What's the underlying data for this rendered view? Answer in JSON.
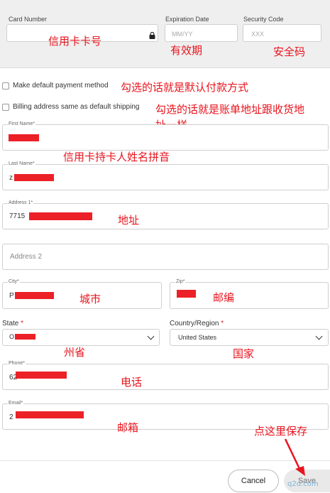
{
  "card": {
    "number_label": "Card Number",
    "expiration_label": "Expiration Date",
    "expiration_placeholder": "MM/YY",
    "security_label": "Security Code",
    "security_placeholder": "XXX",
    "lock_icon": "lock-icon"
  },
  "options": {
    "default_payment_label": "Make default payment method",
    "billing_same_label": "Billing address same as default shipping"
  },
  "fields": {
    "first_name_label": "First Name*",
    "last_name_label": "Last Name*",
    "last_name_value_visible": "z",
    "address1_label": "Address 1*",
    "address1_value_visible": "7715",
    "address2_placeholder": "Address 2",
    "city_label": "City*",
    "city_value_visible": "P",
    "zip_label": "Zip*",
    "state_label": "State",
    "state_required": "*",
    "state_value_visible": "O",
    "country_label": "Country/Region",
    "country_required": "*",
    "country_value": "United States",
    "phone_label": "Phone*",
    "phone_value_visible": "62",
    "email_label": "Email*",
    "email_value_visible": "2"
  },
  "buttons": {
    "cancel": "Cancel",
    "save": "Save"
  },
  "annotations": {
    "card_number": "信用卡卡号",
    "expiration": "有效期",
    "security": "安全码",
    "default_payment": "勾选的话就是默认付款方式",
    "billing_same_line1": "勾选的话就是账单地址跟收货地",
    "billing_same_line2": "址一样",
    "name": "信用卡持卡人姓名拼音",
    "address": "地址",
    "city": "城市",
    "zip": "邮编",
    "state": "州省",
    "country": "国家",
    "phone": "电话",
    "email": "邮箱",
    "save_here": "点这里保存"
  },
  "watermark": {
    "text": "q2d.com"
  },
  "colors": {
    "annotation": "#e8141e",
    "redaction": "#ec2127"
  }
}
